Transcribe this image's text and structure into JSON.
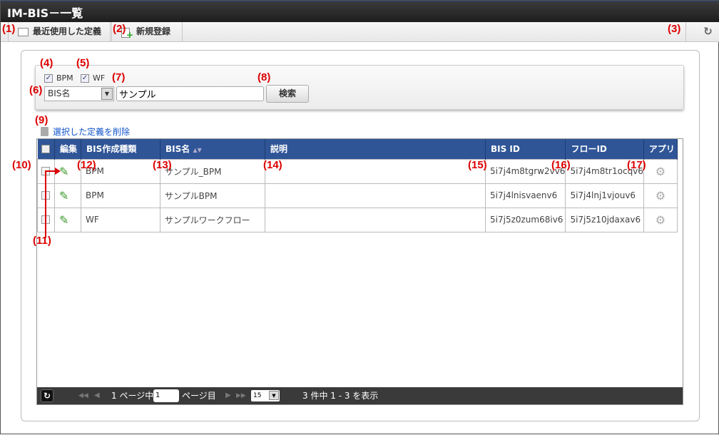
{
  "title": "IM-BIS－一覧",
  "toolbar": {
    "recent": "最近使用した定義",
    "new": "新規登録"
  },
  "search": {
    "bpm_label": "BPM",
    "wf_label": "WF",
    "select_value": "BIS名",
    "keyword": "サンプル",
    "search_button": "検索"
  },
  "delete_link": "選択した定義を削除",
  "table": {
    "headers": [
      "編集",
      "BIS作成種類",
      "BIS名",
      "説明",
      "BIS ID",
      "フローID",
      "アプリ"
    ],
    "sort_indicator": "▲▼",
    "rows": [
      {
        "type": "BPM",
        "name": "サンプル_BPM",
        "desc": "",
        "bis_id": "5i7j4m8tgrw2vv6",
        "flow_id": "5i7j4m8tr1ocqv6"
      },
      {
        "type": "BPM",
        "name": "サンプルBPM",
        "desc": "",
        "bis_id": "5i7j4lnisvaenv6",
        "flow_id": "5i7j4lnj1vjouv6"
      },
      {
        "type": "WF",
        "name": "サンプルワークフロー",
        "desc": "",
        "bis_id": "5i7j5z0zum68iv6",
        "flow_id": "5i7j5z10jdaxav6"
      }
    ]
  },
  "pager": {
    "total_pages_text": "1 ページ中",
    "page": "1",
    "page_suffix": "ページ目",
    "per_page": "15",
    "summary": "3 件中 1 - 3 を表示"
  },
  "annotations": [
    "(1)",
    "(2)",
    "(3)",
    "(4)",
    "(5)",
    "(6)",
    "(7)",
    "(8)",
    "(9)",
    "(10)",
    "(11)",
    "(12)",
    "(13)",
    "(14)",
    "(15)",
    "(16)",
    "(17)"
  ],
  "colors": {
    "header_blue": "#2f5597",
    "annotation_red": "#dd0000",
    "link_blue": "#1155cc"
  }
}
